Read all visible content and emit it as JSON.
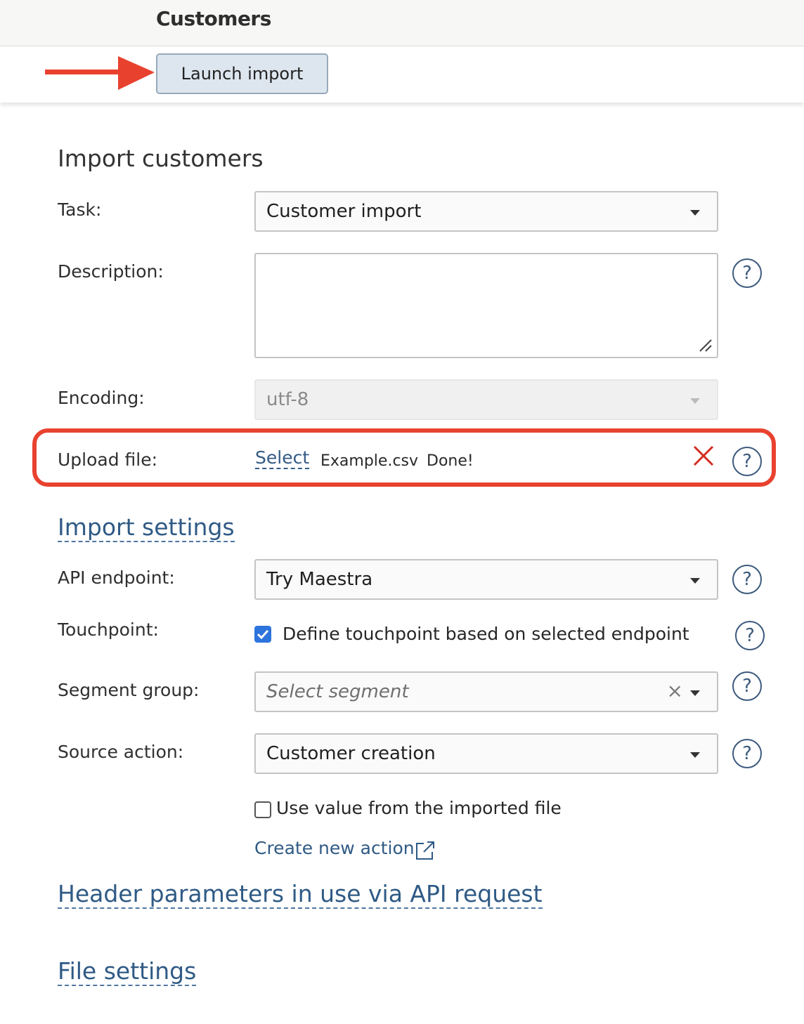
{
  "header": {
    "title": "Customers"
  },
  "toolbar": {
    "launch_label": "Launch import"
  },
  "form": {
    "title": "Import customers",
    "task": {
      "label": "Task:",
      "value": "Customer import"
    },
    "description": {
      "label": "Description:",
      "value": ""
    },
    "encoding": {
      "label": "Encoding:",
      "value": "utf-8"
    },
    "upload": {
      "label": "Upload file:",
      "select_label": "Select",
      "file_name": "Example.csv",
      "status": "Done!"
    }
  },
  "import_settings": {
    "title": "Import settings",
    "api_endpoint": {
      "label": "API endpoint:",
      "value": "Try Maestra"
    },
    "touchpoint": {
      "label": "Touchpoint:",
      "checkbox_label": "Define touchpoint based on selected endpoint",
      "checked": true
    },
    "segment_group": {
      "label": "Segment group:",
      "placeholder": "Select segment"
    },
    "source_action": {
      "label": "Source action:",
      "value": "Customer creation",
      "checkbox_label": "Use value from the imported file",
      "checked": false,
      "create_link": "Create new action"
    }
  },
  "sections": {
    "header_params": "Header parameters in use via API request",
    "file_settings": "File settings"
  },
  "icons": {
    "help": "?",
    "clear": "×",
    "help_icon": "help-circle-icon",
    "remove_icon": "close-icon",
    "external_icon": "external-link-icon",
    "annotation_icon": "arrow-right-icon"
  },
  "colors": {
    "accent_link": "#2f5a85",
    "annotation_red": "#e8422f",
    "checkbox_blue": "#2d74dd",
    "button_bg": "#dde6ef"
  }
}
